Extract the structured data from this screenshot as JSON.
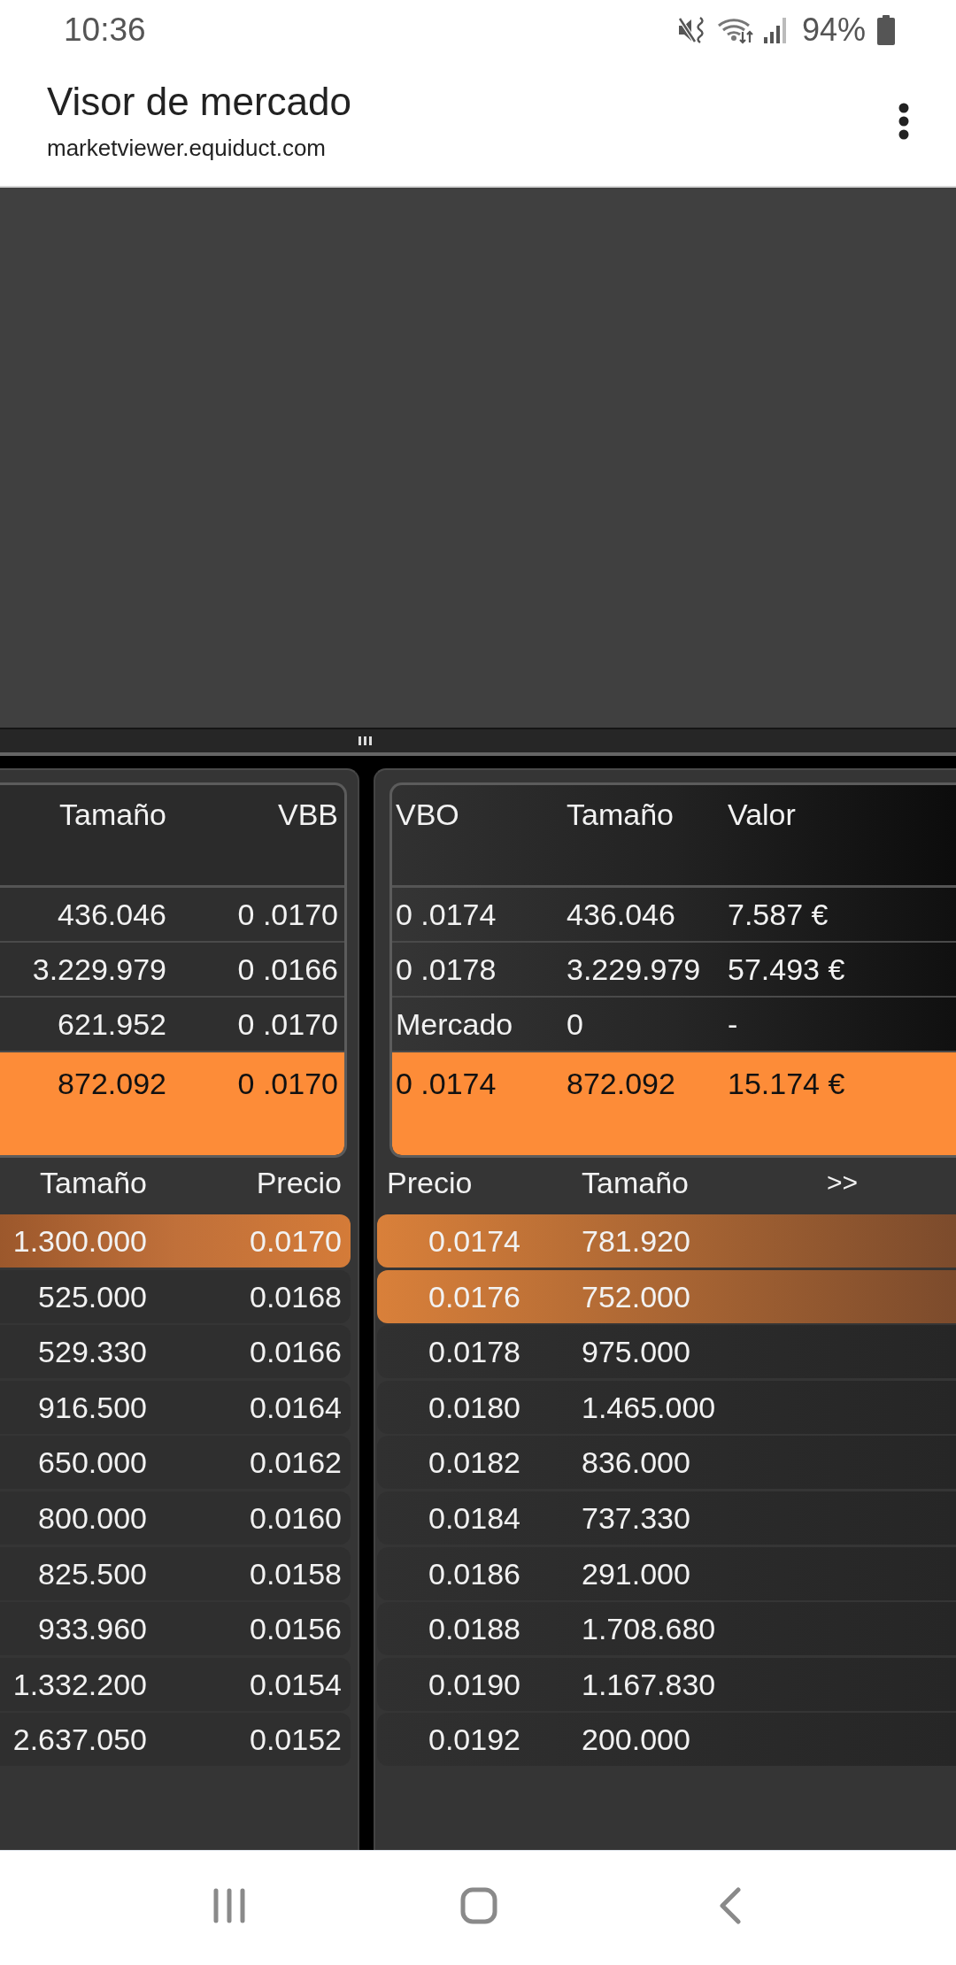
{
  "status_bar": {
    "time": "10:36",
    "battery": "94%"
  },
  "browser_bar": {
    "title": "Visor de mercado",
    "url": "marketviewer.equiduct.com"
  },
  "bid_side": {
    "summary": {
      "columns": [
        "Tamaño",
        "VBB"
      ],
      "rows": [
        {
          "cells": [
            "436.046",
            "0 .0170"
          ],
          "highlighted": false
        },
        {
          "cells": [
            "3.229.979",
            "0 .0166"
          ],
          "highlighted": false
        },
        {
          "cells": [
            "621.952",
            "0 .0170"
          ],
          "highlighted": false
        },
        {
          "cells": [
            "872.092",
            "0 .0170"
          ],
          "highlighted": true
        }
      ]
    },
    "book": {
      "columns": [
        "Tamaño",
        "Precio"
      ],
      "rows": [
        {
          "cells": [
            "1.300.000",
            "0.0170"
          ],
          "highlighted": true
        },
        {
          "cells": [
            "525.000",
            "0.0168"
          ],
          "highlighted": false
        },
        {
          "cells": [
            "529.330",
            "0.0166"
          ],
          "highlighted": false
        },
        {
          "cells": [
            "916.500",
            "0.0164"
          ],
          "highlighted": false
        },
        {
          "cells": [
            "650.000",
            "0.0162"
          ],
          "highlighted": false
        },
        {
          "cells": [
            "800.000",
            "0.0160"
          ],
          "highlighted": false
        },
        {
          "cells": [
            "825.500",
            "0.0158"
          ],
          "highlighted": false
        },
        {
          "cells": [
            "933.960",
            "0.0156"
          ],
          "highlighted": false
        },
        {
          "cells": [
            "1.332.200",
            "0.0154"
          ],
          "highlighted": false
        },
        {
          "cells": [
            "2.637.050",
            "0.0152"
          ],
          "highlighted": false
        }
      ]
    }
  },
  "offer_side": {
    "summary": {
      "columns": [
        "VBO",
        "Tamaño",
        "Valor"
      ],
      "rows": [
        {
          "cells": [
            "0 .0174",
            "436.046",
            "7.587 €"
          ],
          "highlighted": false
        },
        {
          "cells": [
            "0 .0178",
            "3.229.979",
            "57.493 €"
          ],
          "highlighted": false
        },
        {
          "cells": [
            "Mercado",
            "0",
            "-"
          ],
          "highlighted": false
        },
        {
          "cells": [
            "0 .0174",
            "872.092",
            "15.174 €"
          ],
          "highlighted": true
        }
      ]
    },
    "book": {
      "columns": [
        "Precio",
        "Tamaño"
      ],
      "expand_button": ">>",
      "rows": [
        {
          "cells": [
            "0.0174",
            "781.920"
          ],
          "highlighted": true
        },
        {
          "cells": [
            "0.0176",
            "752.000"
          ],
          "highlighted": true
        },
        {
          "cells": [
            "0.0178",
            "975.000"
          ],
          "highlighted": false
        },
        {
          "cells": [
            "0.0180",
            "1.465.000"
          ],
          "highlighted": false
        },
        {
          "cells": [
            "0.0182",
            "836.000"
          ],
          "highlighted": false
        },
        {
          "cells": [
            "0.0184",
            "737.330"
          ],
          "highlighted": false
        },
        {
          "cells": [
            "0.0186",
            "291.000"
          ],
          "highlighted": false
        },
        {
          "cells": [
            "0.0188",
            "1.708.680"
          ],
          "highlighted": false
        },
        {
          "cells": [
            "0.0190",
            "1.167.830"
          ],
          "highlighted": false
        },
        {
          "cells": [
            "0.0192",
            "200.000"
          ],
          "highlighted": false
        }
      ]
    }
  }
}
